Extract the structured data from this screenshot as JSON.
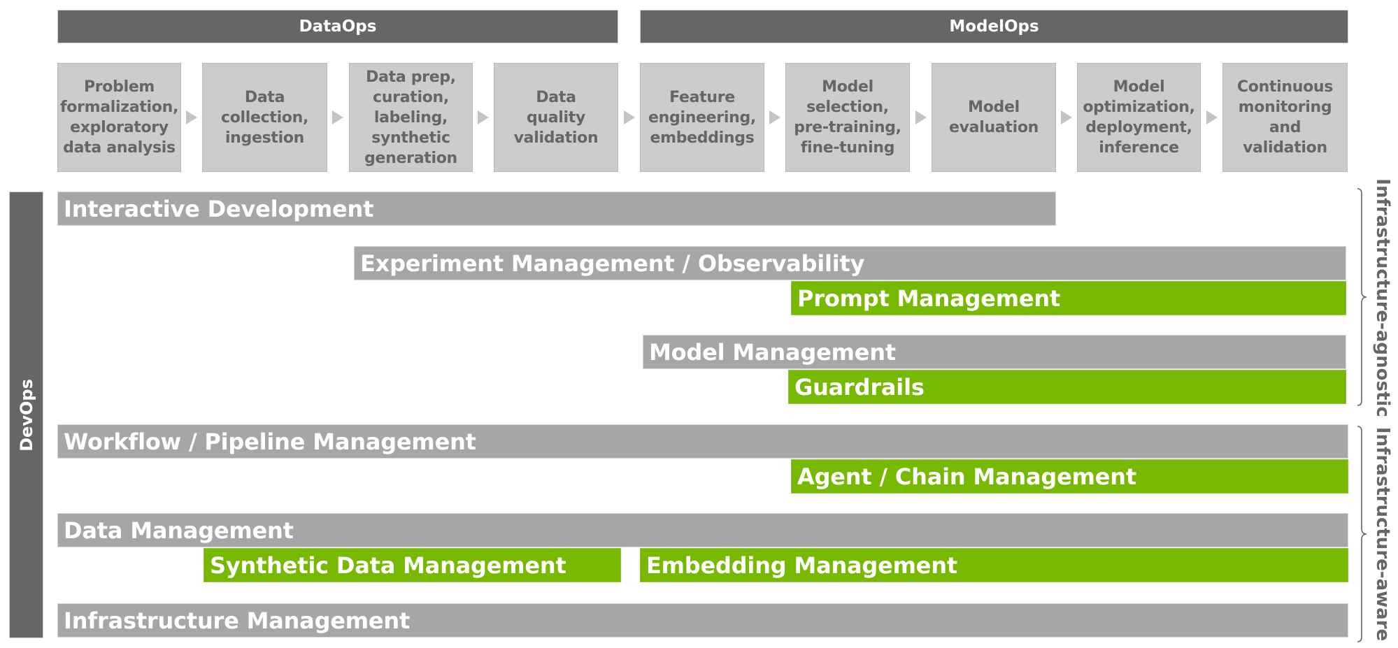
{
  "phases": {
    "dataops": "DataOps",
    "modelops": "ModelOps"
  },
  "steps": [
    "Problem\nformalization,\nexploratory\ndata analysis",
    "Data\ncollection,\ningestion",
    "Data prep,\ncuration,\nlabeling,\nsynthetic\ngeneration",
    "Data\nquality\nvalidation",
    "Feature\nengineering,\nembeddings",
    "Model\nselection,\npre-training,\nfine-tuning",
    "Model\nevaluation",
    "Model\noptimization,\ndeployment,\ninference",
    "Continuous\nmonitoring\nand\nvalidation"
  ],
  "devops_label": "DevOps",
  "bars": {
    "interactive_development": "Interactive Development",
    "experiment_management": "Experiment Management / Observability",
    "prompt_management": "Prompt Management",
    "model_management": "Model Management",
    "guardrails": "Guardrails",
    "workflow_management": "Workflow / Pipeline Management",
    "agent_chain_management": "Agent / Chain Management",
    "data_management": "Data Management",
    "synthetic_data_management": "Synthetic Data Management",
    "embedding_management": "Embedding Management",
    "infrastructure_management": "Infrastructure Management"
  },
  "groups": {
    "infrastructure_agnostic": "Infrastructure-agnostic",
    "infrastructure_aware": "Infrastructure-aware"
  },
  "colors": {
    "dark_gray": "#666666",
    "mid_gray": "#a6a6a6",
    "light_gray": "#cccccc",
    "accent_green": "#76b900"
  }
}
